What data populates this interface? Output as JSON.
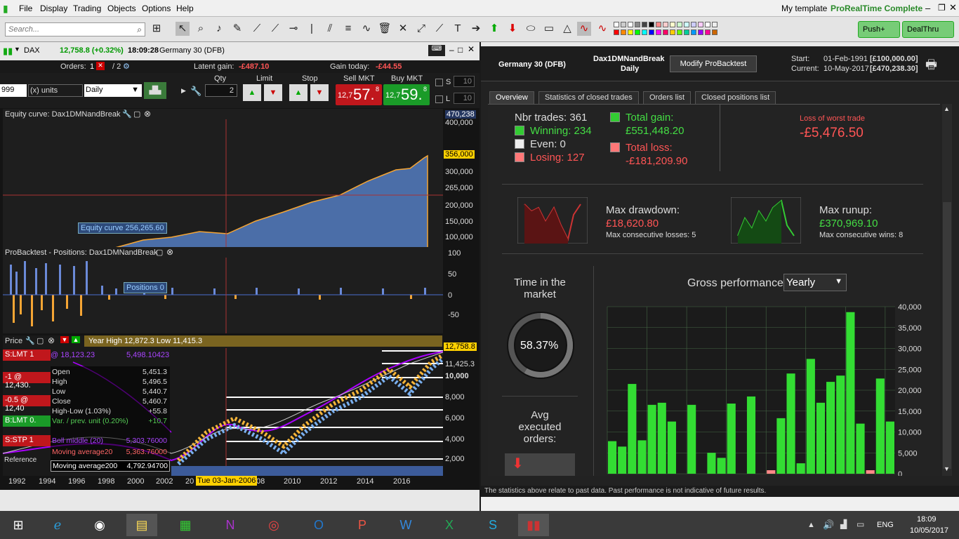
{
  "menu": {
    "file": "File",
    "display": "Display",
    "trading": "Trading",
    "objects": "Objects",
    "options": "Options",
    "help": "Help",
    "template": "My template",
    "product": "ProRealTime Complete"
  },
  "toolbar": {
    "search_placeholder": "Search...",
    "push": "Push+",
    "dealthru": "DealThru"
  },
  "chart_window": {
    "instrument": "DAX",
    "price_change": "12,758.8 (+0.32%)",
    "time": "18:09:28",
    "name": "Germany 30 (DFB)"
  },
  "orders": {
    "label": "Orders:",
    "count_a": "1",
    "count_b": "/ 2",
    "latent_label": "Latent gain:",
    "latent_value": "-£487.10",
    "today_label": "Gain today:",
    "today_value": "-£44.55"
  },
  "trade": {
    "units_value": "999",
    "units_type": "(x) units",
    "timeframe": "Daily",
    "qty_label": "Qty",
    "qty_value": "2",
    "limit_label": "Limit",
    "stop_label": "Stop",
    "sell_label": "Sell MKT",
    "sell_prefix": "12,7",
    "sell_value": "57.",
    "sell_sup": "8",
    "buy_label": "Buy MKT",
    "buy_prefix": "12,7",
    "buy_value": "59.",
    "buy_sup": "8",
    "s_label": "S",
    "s_value": "10",
    "l_label": "L",
    "l_value": "10"
  },
  "equity": {
    "title": "Equity curve: Dax1DMNandBreak",
    "label": "Equity curve   256,265.60",
    "axis": [
      "470,238",
      "400,000",
      "356,000",
      "300,000",
      "265,000",
      "200,000",
      "150,000",
      "100,000"
    ]
  },
  "positions": {
    "title": "ProBacktest - Positions: Dax1DMNandBreak",
    "label": "Positions   0",
    "axis": [
      "100",
      "50",
      "0",
      "-50"
    ]
  },
  "price": {
    "title": "Price",
    "header": "Year High 12,872.3 Low 11,415.3",
    "axis": [
      "12,758.8",
      "11,425.3",
      "10,000",
      "8,000",
      "6,000",
      "4,000",
      "2,000"
    ],
    "order1": "S:LMT 1",
    "order1_val": "@ 18,123.23",
    "order1_right": "5,498.10423",
    "order2": "-1 @ 12,430.",
    "order3": "-0.5 @ 12,40",
    "order4": "B:LMT 0.",
    "order5": "S:STP 1",
    "ref": "Reference",
    "tooltip": [
      [
        "Open",
        "5,451.3"
      ],
      [
        "High",
        "5,496.5"
      ],
      [
        "Low",
        "5,440.7"
      ],
      [
        "Close",
        "5,460.7"
      ],
      [
        "High-Low (1.03%)",
        "+55.8"
      ],
      [
        "Var. / prev. unit (0.20%)",
        "+10.7"
      ],
      [
        "Boll middle (20)",
        "5,303.76000"
      ],
      [
        "Moving average20",
        "5,363.76000"
      ],
      [
        "Moving average200",
        "4,792.94700"
      ]
    ],
    "xaxis": [
      "1992",
      "1994",
      "1996",
      "1998",
      "2000",
      "2002",
      "20",
      "08",
      "2010",
      "2012",
      "2014",
      "2016"
    ],
    "cursor_date": "Tue 03-Jan-2006"
  },
  "bt": {
    "instrument": "Germany 30 (DFB)",
    "system": "Dax1DMNandBreak",
    "period": "Daily",
    "modify": "Modify ProBacktest",
    "start_label": "Start:",
    "start_val": "01-Feb-1991",
    "start_cap": "[£100,000.00]",
    "current_label": "Current:",
    "current_val": "10-May-2017",
    "current_cap": "[£470,238.30]"
  },
  "tabs": [
    "Overview",
    "Statistics of closed trades",
    "Orders list",
    "Closed positions list"
  ],
  "overview": {
    "nbr": "Nbr trades: 361",
    "winning": "Winning: 234",
    "even": "Even: 0",
    "losing": "Losing: 127",
    "gain_label": "Total gain:",
    "gain_val": "£551,448.20",
    "loss_label": "Total loss:",
    "loss_val": "-£181,209.90",
    "worst_label": "Loss of worst trade",
    "worst_val": "-£5,476.50",
    "dd_label": "Max drawdown:",
    "dd_val": "£18,620.80",
    "dd_sub": "Max consecutive losses: 5",
    "ru_label": "Max runup:",
    "ru_val": "£370,969.10",
    "ru_sub": "Max consecutive wins: 8",
    "time_label": "Time in the market",
    "time_val": "58.37%",
    "avg_label": "Avg executed orders:",
    "gross_label": "Gross performance",
    "gross_period": "Yearly"
  },
  "chart_data": {
    "type": "bar",
    "title": "Gross performance",
    "yaxis": [
      "40,000",
      "35,000",
      "30,000",
      "25,000",
      "20,000",
      "15,000",
      "10,000",
      "5,000",
      "0"
    ],
    "ylim": [
      0,
      40000
    ],
    "values": [
      7800,
      6500,
      21500,
      8000,
      16500,
      17000,
      12500,
      0,
      16500,
      0,
      5000,
      3800,
      16800,
      0,
      18500,
      0,
      0,
      13300,
      24000,
      2500,
      27500,
      17000,
      22000,
      23500,
      38700,
      12000,
      0,
      22800,
      12500
    ],
    "negatives": [
      false,
      false,
      false,
      false,
      false,
      false,
      false,
      false,
      false,
      false,
      false,
      false,
      false,
      false,
      false,
      false,
      true,
      false,
      false,
      false,
      false,
      false,
      false,
      false,
      false,
      false,
      true,
      false,
      false
    ],
    "colors": {
      "bar": "#33dd33",
      "negative": "#ff8888",
      "grid": "#446644"
    }
  },
  "status": "The statistics above relate to past data. Past performance is not indicative of future results.",
  "taskbar": {
    "lang": "ENG",
    "time": "18:09",
    "date": "10/05/2017"
  }
}
